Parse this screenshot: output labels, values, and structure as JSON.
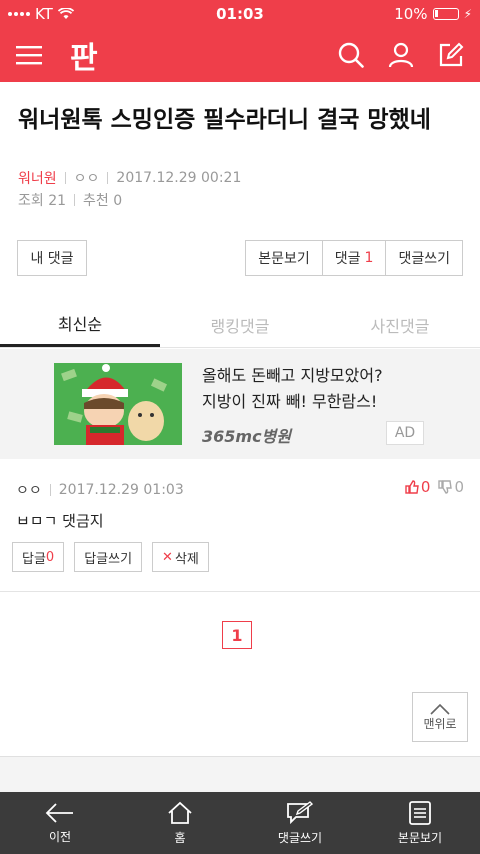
{
  "status": {
    "carrier": "KT",
    "time": "01:03",
    "battery": "10%"
  },
  "appbar": {
    "logo": "판"
  },
  "article": {
    "title": "워너원톡 스밍인증 필수라더니 결국 망했네",
    "category": "워너원",
    "author": "ㅇㅇ",
    "datetime": "2017.12.29 00:21",
    "views": "조회 21",
    "recommend": "추천 0"
  },
  "buttons": {
    "my_comment": "내 댓글",
    "view_body": "본문보기",
    "comments": "댓글",
    "comment_count": "1",
    "write_comment": "댓글쓰기"
  },
  "tabs": [
    {
      "label": "최신순"
    },
    {
      "label": "랭킹댓글"
    },
    {
      "label": "사진댓글"
    }
  ],
  "ad": {
    "line1": "올해도 돈빼고 지방모았어?",
    "line2": "지방이 진짜 빼! 무한람스!",
    "brand": "365mc병원",
    "label": "AD"
  },
  "comment": {
    "author": "ㅇㅇ",
    "datetime": "2017.12.29 01:03",
    "up": "0",
    "down": "0",
    "text": "ㅂㅁㄱ 댓금지",
    "reply_label": "답글",
    "reply_count": "0",
    "write_reply": "답글쓰기",
    "delete": "삭제"
  },
  "pager": {
    "current": "1"
  },
  "totop": {
    "label": "맨위로"
  },
  "bottom_nav": [
    {
      "label": "이전",
      "icon": "back-arrow-icon"
    },
    {
      "label": "홈",
      "icon": "home-icon"
    },
    {
      "label": "댓글쓰기",
      "icon": "write-comment-icon"
    },
    {
      "label": "본문보기",
      "icon": "document-icon"
    }
  ],
  "colors": {
    "brand": "#ef3e4a",
    "bottom_bar": "#3b3b3b"
  }
}
